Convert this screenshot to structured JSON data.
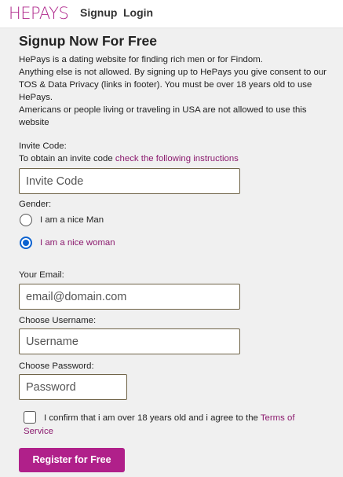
{
  "header": {
    "logo": "HEPAYS",
    "nav": {
      "signup": "Signup",
      "login": "Login"
    }
  },
  "page": {
    "title": "Signup Now For Free",
    "intro": [
      "HePays is a dating website for finding rich men or for Findom.",
      "Anything else is not allowed. By signing up to HePays you give consent to our TOS & Data Privacy (links in footer). You must be over 18 years old to use HePays.",
      "Americans or people living or traveling in USA are not allowed to use this website"
    ]
  },
  "form": {
    "invite": {
      "label": "Invite Code:",
      "help_prefix": "To obtain an invite code",
      "help_link": "check the following instructions",
      "placeholder": "Invite Code"
    },
    "gender": {
      "label": "Gender:",
      "options": [
        {
          "label": "I am a nice Man",
          "checked": false
        },
        {
          "label": "I am a nice woman",
          "checked": true
        }
      ]
    },
    "email": {
      "label": "Your Email:",
      "placeholder": "email@domain.com"
    },
    "username": {
      "label": "Choose Username:",
      "placeholder": "Username"
    },
    "password": {
      "label": "Choose Password:",
      "placeholder": "Password"
    },
    "confirm": {
      "text": "I confirm that i am over 18 years old and i agree to the",
      "link": "Terms of Service",
      "checked": false
    },
    "submit_label": "Register for Free"
  },
  "colors": {
    "brand": "#b0208a",
    "link": "#8b1a6e",
    "radio_selected": "#0b62d0"
  }
}
